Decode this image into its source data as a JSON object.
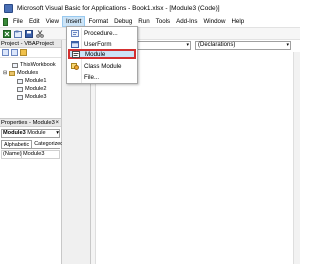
{
  "window": {
    "title": "Microsoft Visual Basic for Applications - Book1.xlsx - [Module3 (Code)]"
  },
  "menubar": {
    "items": [
      "File",
      "Edit",
      "View",
      "Insert",
      "Format",
      "Debug",
      "Run",
      "Tools",
      "Add-Ins",
      "Window",
      "Help"
    ],
    "active": "Insert"
  },
  "insert_menu": {
    "items": [
      {
        "label": "Procedure...",
        "icon": "procedure-icon"
      },
      {
        "label": "UserForm",
        "icon": "userform-icon"
      },
      {
        "label": "Module",
        "icon": "module-icon",
        "highlighted": true
      },
      {
        "label": "Class Module",
        "icon": "class-module-icon"
      },
      {
        "label": "File...",
        "icon": ""
      }
    ],
    "highlight_color": "#d32f2f"
  },
  "project_panel": {
    "title": "Project - VBAProject",
    "tree": [
      "ThisWorkbook",
      "Modules",
      "Module1",
      "Module2",
      "Module3"
    ]
  },
  "properties_panel": {
    "title": "Properties - Module3",
    "close_glyph": "×",
    "object_name": "Module3",
    "object_type": "Module",
    "tabs": [
      "Alphabetic",
      "Categorized"
    ],
    "row": {
      "name": "(Name)",
      "value": "Module3"
    }
  },
  "code_window": {
    "procedure_combo": "(Declarations)"
  },
  "colors": {
    "menu_hover": "#cce4f7",
    "accent": "#4a6fb5"
  }
}
